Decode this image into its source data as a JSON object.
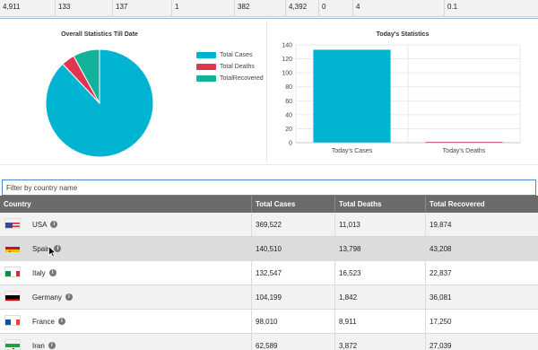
{
  "top_strip": [
    "4,911",
    "133",
    "137",
    "1",
    "382",
    "4,392",
    "0",
    "4",
    "0.1"
  ],
  "pie_chart": {
    "title": "Overall Statistics Till Date",
    "legend": [
      {
        "label": "Total Cases",
        "color": "#00b3d1"
      },
      {
        "label": "Total Deaths",
        "color": "#e0354f"
      },
      {
        "label": "TotalRecovered",
        "color": "#13b29a"
      }
    ]
  },
  "bar_chart": {
    "title": "Today's Statistics"
  },
  "chart_data": [
    {
      "type": "pie",
      "title": "Overall Statistics Till Date",
      "labels": [
        "Total Cases",
        "Total Deaths",
        "TotalRecovered"
      ],
      "values": [
        88,
        4,
        8
      ],
      "colors": [
        "#00b3d1",
        "#e0354f",
        "#13b29a"
      ],
      "legend": "right"
    },
    {
      "type": "bar",
      "title": "Today's Statistics",
      "categories": [
        "Today's Cases",
        "Today's Deaths"
      ],
      "values": [
        133,
        1
      ],
      "colors": [
        "#00b3d1",
        "#e0354f"
      ],
      "ylim": [
        0,
        140
      ],
      "yticks": [
        0,
        20,
        40,
        60,
        80,
        100,
        120,
        140
      ],
      "grid": true
    }
  ],
  "filter": {
    "placeholder": "Filter by country name"
  },
  "table": {
    "headers": [
      "Country",
      "Total Cases",
      "Total Deaths",
      "Total Recovered"
    ],
    "info_glyph": "i",
    "rows": [
      {
        "country": "USA",
        "flag": "us-flag-icon",
        "cases": "369,522",
        "deaths": "11,013",
        "recovered": "19,874"
      },
      {
        "country": "Spain",
        "flag": "spain-flag-icon",
        "cases": "140,510",
        "deaths": "13,798",
        "recovered": "43,208"
      },
      {
        "country": "Italy",
        "flag": "italy-flag-icon",
        "cases": "132,547",
        "deaths": "16,523",
        "recovered": "22,837"
      },
      {
        "country": "Germany",
        "flag": "germany-flag-icon",
        "cases": "104,199",
        "deaths": "1,842",
        "recovered": "36,081"
      },
      {
        "country": "France",
        "flag": "france-flag-icon",
        "cases": "98,010",
        "deaths": "8,911",
        "recovered": "17,250"
      },
      {
        "country": "Iran",
        "flag": "iran-flag-icon",
        "cases": "62,589",
        "deaths": "3,872",
        "recovered": "27,039"
      }
    ]
  }
}
